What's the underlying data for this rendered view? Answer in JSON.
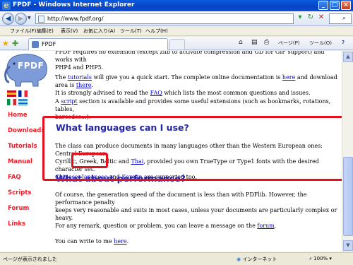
{
  "window": {
    "title": "FPDF - Windows Internet Explorer"
  },
  "address_bar": {
    "url": "http://www.fpdf.org/"
  },
  "menu": {
    "items": [
      "ファイル(F)",
      "編集(E)",
      "表示(V)",
      "お気に入り(A)",
      "ツール(T)",
      "ヘルプ(H)"
    ]
  },
  "tab": {
    "label": "FPDF"
  },
  "toolbar": {
    "page_label": "ページ(P)",
    "tools_label": "ツール(O)"
  },
  "logo": {
    "text": "FPDF"
  },
  "sidebar": {
    "links": [
      "Home",
      "Downloads",
      "Tutorials",
      "Manual",
      "FAQ",
      "Scripts",
      "Forum",
      "Links"
    ]
  },
  "main": {
    "intro_line": "FPDF requires no extension (except zlib to activate compression and GD for GIF support) and works with",
    "intro_line2": "PHP4 and PHP5.",
    "tutorials_pre": "The ",
    "tutorials_link": "tutorials",
    "tutorials_mid": " will give you a quick start. The complete online documentation is ",
    "here_link": "here",
    "tutorials_mid2": " and download area is ",
    "there_link": "there",
    "tutorials_end": ".",
    "tutorials_line2_pre": "It is strongly advised to read the ",
    "faq_link": "FAQ",
    "tutorials_line2_end": " which lists the most common questions and issues.",
    "script_pre": "A ",
    "script_link": "script",
    "script_end": " section is available and provides some useful extensions (such as bookmarks, rotations, tables,",
    "script_line2": "barcodes...).",
    "h_languages": "What languages can I use?",
    "lang_line1": "The class can produce documents in many languages other than the Western European ones: Central European,",
    "lang_line2_pre": "Cyrillic, Greek, Baltic and ",
    "thai_link": "Thai",
    "lang_line2_end": ", provided you own TrueType or Type1 fonts with the desired character set.",
    "chinese_link": "Chinese",
    "sep1": ", ",
    "japanese_link": "Japanese",
    "sep2": " and ",
    "korean_link": "Korean",
    "lang_line3_end": " are supported too.",
    "h_performance": "What about performance?",
    "perf_line1": "Of course, the generation speed of the document is less than with PDFlib. However, the performance penalty",
    "perf_line2": "keeps very reasonable and suits in most cases, unless your documents are particularly complex or heavy.",
    "remark_pre": "For any remark, question or problem, you can leave a message on the ",
    "forum_link": "forum",
    "remark_end": ".",
    "write_pre": "You can write to me ",
    "write_link": "here",
    "write_end": "."
  },
  "status": {
    "text": "ページが表示されました",
    "zone": "インターネット",
    "zoom": "100%"
  },
  "colors": {
    "nav_link": "#e8202a",
    "heading": "#2424a6",
    "link": "#0000cc",
    "highlight": "#e3101d"
  }
}
